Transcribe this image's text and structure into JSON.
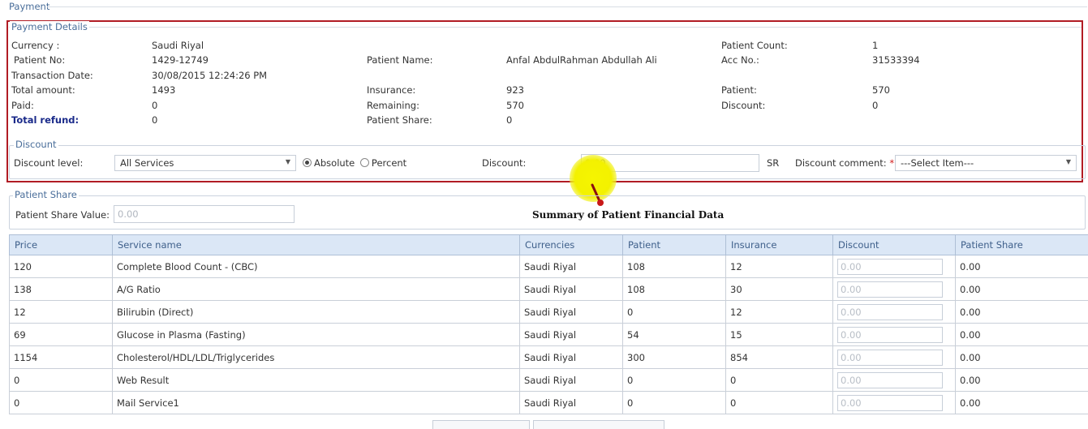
{
  "section_title": "Payment",
  "payment_details": {
    "legend": "Payment Details",
    "currency_label": "Currency :",
    "currency_value": "Saudi Riyal",
    "patient_count_label": "Patient Count:",
    "patient_count_value": "1",
    "patient_no_label": "Patient No:",
    "patient_no_value": "1429-12749",
    "patient_name_label": "Patient Name:",
    "patient_name_value": "Anfal AbdulRahman Abdullah Ali",
    "acc_no_label": "Acc No.:",
    "acc_no_value": "31533394",
    "transaction_date_label": "Transaction Date:",
    "transaction_date_value": "30/08/2015 12:24:26 PM",
    "total_amount_label": "Total amount:",
    "total_amount_value": "1493",
    "insurance_label": "Insurance:",
    "insurance_value": "923",
    "patient_label": "Patient:",
    "patient_value": "570",
    "paid_label": "Paid:",
    "paid_value": "0",
    "remaining_label": "Remaining:",
    "remaining_value": "570",
    "discount_label": "Discount:",
    "discount_value": "0",
    "total_refund_label": "Total refund:",
    "total_refund_value": "0",
    "patient_share_label": "Patient Share:",
    "patient_share_value": "0"
  },
  "discount": {
    "legend": "Discount",
    "level_label": "Discount level:",
    "level_value": "All Services",
    "absolute_label": "Absolute",
    "percent_label": "Percent",
    "selected_mode": "Absolute",
    "discount_label": "Discount:",
    "discount_value": "0.00",
    "currency_suffix": "SR",
    "comment_label": "Discount comment:",
    "required_mark": "*",
    "comment_value": "---Select Item---"
  },
  "patient_share": {
    "legend": "Patient Share",
    "value_label": "Patient Share Value:",
    "value_placeholder": "0.00"
  },
  "annotation": {
    "text": "Summary of Patient Financial Data",
    "marker_color": "#f3f100"
  },
  "table": {
    "headers": [
      "Price",
      "Service name",
      "Currencies",
      "Patient",
      "Insurance",
      "Discount",
      "Patient Share"
    ],
    "rows": [
      {
        "price": "120",
        "service": "Complete Blood Count - (CBC)",
        "currency": "Saudi Riyal",
        "patient": "108",
        "insurance": "12",
        "discount": "0.00",
        "share": "0.00"
      },
      {
        "price": "138",
        "service": "A/G Ratio",
        "currency": "Saudi Riyal",
        "patient": "108",
        "insurance": "30",
        "discount": "0.00",
        "share": "0.00"
      },
      {
        "price": "12",
        "service": "Bilirubin (Direct)",
        "currency": "Saudi Riyal",
        "patient": "0",
        "insurance": "12",
        "discount": "0.00",
        "share": "0.00"
      },
      {
        "price": "69",
        "service": "Glucose in Plasma (Fasting)",
        "currency": "Saudi Riyal",
        "patient": "54",
        "insurance": "15",
        "discount": "0.00",
        "share": "0.00"
      },
      {
        "price": "1154",
        "service": "Cholesterol/HDL/LDL/Triglycerides",
        "currency": "Saudi Riyal",
        "patient": "300",
        "insurance": "854",
        "discount": "0.00",
        "share": "0.00"
      },
      {
        "price": "0",
        "service": "Web Result",
        "currency": "Saudi Riyal",
        "patient": "0",
        "insurance": "0",
        "discount": "0.00",
        "share": "0.00"
      },
      {
        "price": "0",
        "service": "Mail Service1",
        "currency": "Saudi Riyal",
        "patient": "0",
        "insurance": "0",
        "discount": "0.00",
        "share": "0.00"
      }
    ]
  },
  "colors": {
    "highlight_border": "#b11c24",
    "header_bg": "#dbe7f6",
    "legend_text": "#4a6e9a",
    "total_refund_text": "#1a2a8a"
  }
}
